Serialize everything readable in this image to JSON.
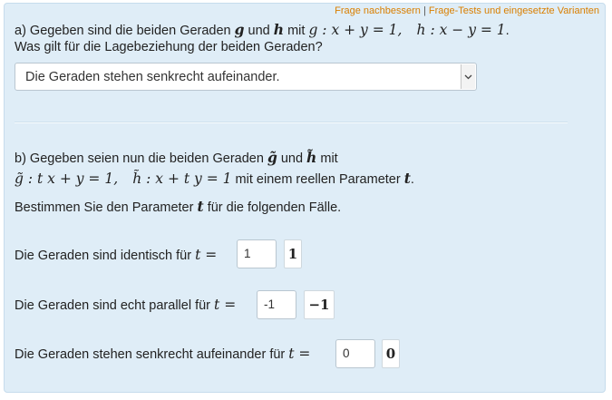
{
  "links": {
    "improve": "Frage nachbessern",
    "separator": "|",
    "tests": "Frage-Tests und eingesetzte Varianten"
  },
  "part_a": {
    "line1_prefix": "a) Gegeben sind die beiden Geraden",
    "g": "g",
    "und": "und",
    "h": "h",
    "mit": "mit",
    "eq_g": "g : x + y = 1,",
    "eq_h": "h : x − y = 1",
    "period": ".",
    "question": "Was gilt für die Lagebeziehung der beiden Geraden?",
    "select_value": "Die Geraden stehen senkrecht aufeinander."
  },
  "part_b": {
    "line1_prefix": "b) Gegeben seien nun die beiden Geraden",
    "g_tilde": "g̃",
    "und": "und",
    "h_tilde": "h̃",
    "mit": "mit",
    "eq_g": "g̃ : t x + y = 1,",
    "eq_h": "h̃ : x + t y = 1",
    "param_text": "mit einem reellen Parameter",
    "t": "t",
    "period": ".",
    "instruction_prefix": "Bestimmen Sie den Parameter",
    "instruction_suffix": "für die folgenden Fälle.",
    "cases": [
      {
        "label": "Die Geraden sind identisch für",
        "var": "t =",
        "input": "1",
        "feedback": "1"
      },
      {
        "label": "Die Geraden sind echt parallel für",
        "var": "t =",
        "input": "-1",
        "feedback": "−1"
      },
      {
        "label": "Die Geraden stehen senkrecht aufeinander für",
        "var": "t =",
        "input": "0",
        "feedback": "0"
      }
    ]
  }
}
